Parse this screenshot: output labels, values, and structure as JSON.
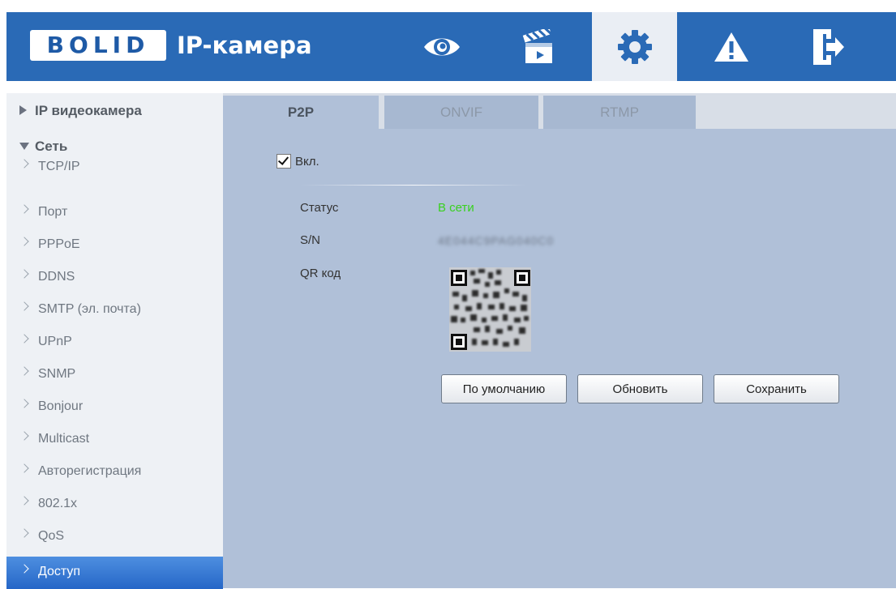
{
  "header": {
    "logo_text": "BOLID",
    "title": "IP-камера",
    "nav": [
      {
        "name": "live-view",
        "icon": "eye-icon"
      },
      {
        "name": "playback",
        "icon": "clapperboard-icon"
      },
      {
        "name": "settings",
        "icon": "gear-icon",
        "active": true
      },
      {
        "name": "alarm",
        "icon": "warning-icon"
      },
      {
        "name": "logout",
        "icon": "exit-icon"
      }
    ],
    "colors": {
      "bar": "#2a6ab6",
      "active_bg": "#eaeef4"
    }
  },
  "sidebar": {
    "sections": [
      {
        "label": "IP видеокамера",
        "expanded": false
      },
      {
        "label": "Сеть",
        "expanded": true
      }
    ],
    "items": [
      "TCP/IP",
      "Порт",
      "PPPoE",
      "DDNS",
      "SMTP (эл. почта)",
      "UPnP",
      "SNMP",
      "Bonjour",
      "Multicast",
      "Авторегистрация",
      "802.1x",
      "QoS",
      "Доступ"
    ],
    "active_item": "Доступ"
  },
  "tabs": [
    "P2P",
    "ONVIF",
    "RTMP"
  ],
  "active_tab": "P2P",
  "p2p": {
    "enable_label": "Вкл.",
    "enabled": true,
    "status_label": "Статус",
    "status_value": "В сети",
    "sn_label": "S/N",
    "sn_value": "4E044C9PAG040C0",
    "qr_label": "QR код",
    "status_color": "#39d11f"
  },
  "buttons": {
    "default": "По умолчанию",
    "refresh": "Обновить",
    "save": "Сохранить"
  }
}
